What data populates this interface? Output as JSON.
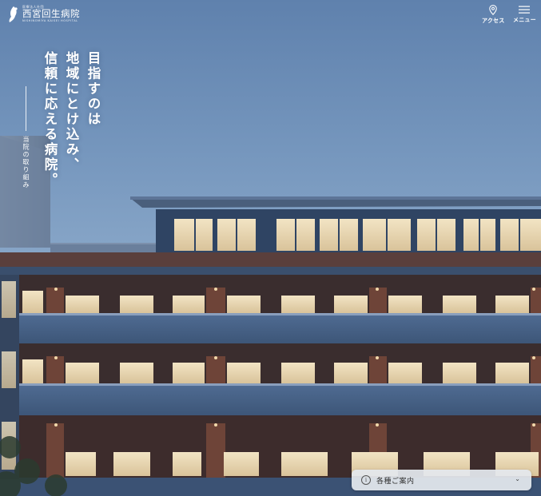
{
  "header": {
    "logo": {
      "small_text": "医療法人社団",
      "name": "西宮回生病院",
      "en_name": "NISHINOMIYA KAISEI HOSPITAL"
    },
    "access_label": "アクセス",
    "menu_label": "メニュー"
  },
  "hero": {
    "catch_copy": "目指すのは\n地域にとけ込み、\n信頼に応える病院。",
    "initiatives_link": "当院の取り組み"
  },
  "guide": {
    "label": "各種ご案内"
  },
  "icons": [
    "logo-mark-icon",
    "map-pin-icon",
    "hamburger-menu-icon",
    "info-icon",
    "chevron-down-icon"
  ]
}
